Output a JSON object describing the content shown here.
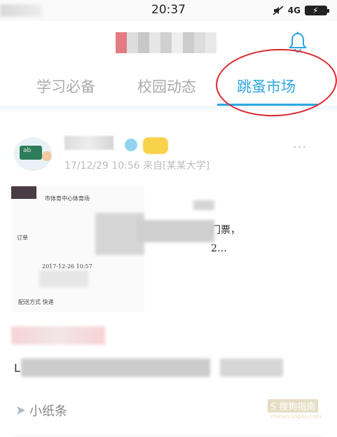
{
  "status_bar": {
    "time": "20:37",
    "network": "4G"
  },
  "header": {
    "title_blur_colors": [
      "#e27b82",
      "#dddddd",
      "#c8c8c8",
      "#e6e6e6",
      "#d0d0d0",
      "#eeeeee",
      "#cccccc",
      "#dddddd",
      "#e9e9e9"
    ]
  },
  "tabs": [
    {
      "label": "学习必备",
      "active": false
    },
    {
      "label": "校园动态",
      "active": false
    },
    {
      "label": "跳蚤市场",
      "active": true
    }
  ],
  "colors": {
    "accent": "#2ea7e0",
    "highlight_circle": "#d9272e"
  },
  "post": {
    "meta": "17/12/29 10:56 来自[某某大学]",
    "more_label": "···",
    "doc_left_lines": [
      "市体育中心体育场",
      "订单",
      "2017-12-26 10:57",
      "配送方式 快递"
    ],
    "doc_right_lines": [
      "门票，",
      "2…"
    ],
    "desc_prefix": "L"
  },
  "note": {
    "label": "小纸条"
  },
  "watermark": {
    "main": "S 搜狗指南",
    "sub": "zhinan.sogou.com"
  }
}
